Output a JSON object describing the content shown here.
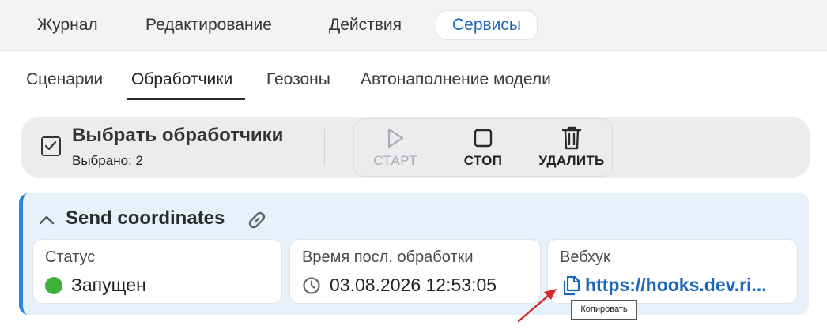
{
  "top_tabs": [
    {
      "label": "Журнал",
      "active": false
    },
    {
      "label": "Редактирование",
      "active": false
    },
    {
      "label": "Действия",
      "active": false
    },
    {
      "label": "Сервисы",
      "active": true
    }
  ],
  "sub_tabs": [
    {
      "label": "Сценарии",
      "active": false
    },
    {
      "label": "Обработчики",
      "active": true
    },
    {
      "label": "Геозоны",
      "active": false
    },
    {
      "label": "Автонаполнение модели",
      "active": false
    }
  ],
  "toolbar": {
    "select_title": "Выбрать обработчики",
    "select_count": "Выбрано: 2",
    "actions": [
      {
        "label": "СТАРТ",
        "icon": "play-icon",
        "enabled": false
      },
      {
        "label": "СТОП",
        "icon": "stop-icon",
        "enabled": true
      },
      {
        "label": "УДАЛИТЬ",
        "icon": "trash-icon",
        "enabled": true
      }
    ]
  },
  "card": {
    "title": "Send coordinates",
    "fields": {
      "status": {
        "label": "Статус",
        "value": "Запущен",
        "color": "#3fb23a"
      },
      "last_processed": {
        "label": "Время посл. обработки",
        "value": "03.08.2026 12:53:05"
      },
      "webhook": {
        "label": "Вебхук",
        "value": "https://hooks.dev.ri..."
      }
    }
  },
  "tooltip": {
    "text": "Копировать"
  },
  "colors": {
    "accent": "#1b66b8",
    "card_bg": "#e7f1fb",
    "card_border": "#2b86e0",
    "arrow": "#d42a2a"
  }
}
